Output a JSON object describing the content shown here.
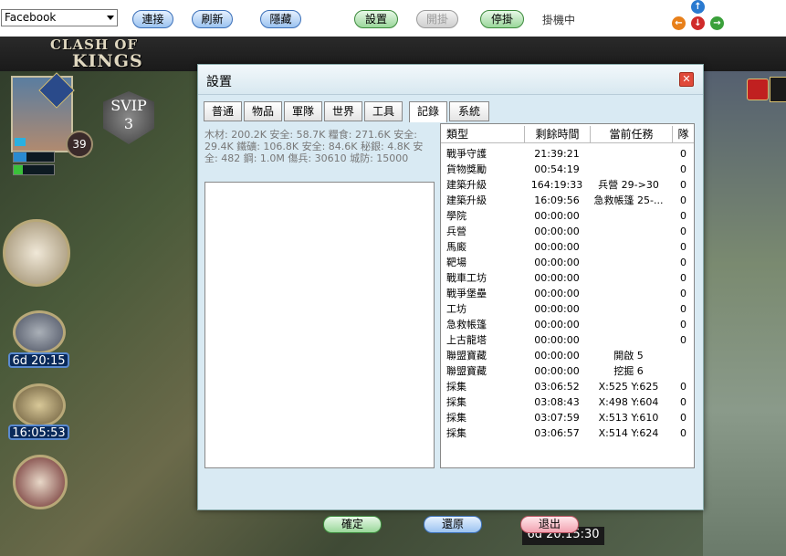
{
  "toolbar": {
    "account_select": "Facebook",
    "buttons": {
      "connect": "連接",
      "refresh": "刷新",
      "hide": "隱藏",
      "settings": "設置",
      "start": "開掛",
      "stop": "停掛"
    },
    "status": "掛機中"
  },
  "game": {
    "logo_line1": "CLASH OF",
    "logo_line2": "KINGS",
    "player_level": "39",
    "svip_label": "SVIP",
    "svip_level": "3",
    "timer1": "6d 20:15",
    "timer2": "16:05:53",
    "bottom_timer": "6d 20:15:30"
  },
  "dialog": {
    "title": "設置",
    "tabs": [
      "普通",
      "物品",
      "軍隊",
      "世界",
      "工具",
      "記錄",
      "系統"
    ],
    "active_tab": "記錄",
    "resources_text": "木材: 200.2K 安全: 58.7K 糧食: 271.6K 安全: 29.4K 鐵礦: 106.8K 安全: 84.6K 秘銀: 4.8K 安全: 482 鋼: 1.0M 傷兵: 30610 城防: 15000",
    "table": {
      "headers": [
        "類型",
        "剩餘時間",
        "當前任務",
        "隊"
      ],
      "rows": [
        [
          "戰爭守護",
          "21:39:21",
          "",
          "0"
        ],
        [
          "貨物獎勵",
          "00:54:19",
          "",
          "0"
        ],
        [
          "建築升級",
          "164:19:33",
          "兵營 29->30",
          "0"
        ],
        [
          "建築升級",
          "16:09:56",
          "急救帳篷 25-...",
          "0"
        ],
        [
          "學院",
          "00:00:00",
          "",
          "0"
        ],
        [
          "兵營",
          "00:00:00",
          "",
          "0"
        ],
        [
          "馬廄",
          "00:00:00",
          "",
          "0"
        ],
        [
          "靶場",
          "00:00:00",
          "",
          "0"
        ],
        [
          "戰車工坊",
          "00:00:00",
          "",
          "0"
        ],
        [
          "戰爭堡壘",
          "00:00:00",
          "",
          "0"
        ],
        [
          "工坊",
          "00:00:00",
          "",
          "0"
        ],
        [
          "急救帳篷",
          "00:00:00",
          "",
          "0"
        ],
        [
          "上古龍塔",
          "00:00:00",
          "",
          "0"
        ],
        [
          "聯盟寶藏",
          "00:00:00",
          "開啟 5",
          ""
        ],
        [
          "聯盟寶藏",
          "00:00:00",
          "挖掘 6",
          ""
        ],
        [
          "採集",
          "03:06:52",
          "X:525 Y:625",
          "0"
        ],
        [
          "採集",
          "03:08:43",
          "X:498 Y:604",
          "0"
        ],
        [
          "採集",
          "03:07:59",
          "X:513 Y:610",
          "0"
        ],
        [
          "採集",
          "03:06:57",
          "X:514 Y:624",
          "0"
        ]
      ]
    },
    "buttons": {
      "ok": "確定",
      "restore": "還原",
      "exit": "退出"
    }
  },
  "colors": {
    "nav_up": "#2a7ad0",
    "nav_left": "#e8801a",
    "nav_down": "#d02a2a",
    "nav_right": "#3aa03a"
  }
}
